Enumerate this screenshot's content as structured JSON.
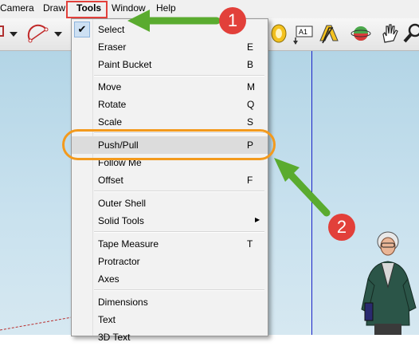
{
  "menubar": {
    "items": [
      "Camera",
      "Draw",
      "Tools",
      "Window",
      "Help"
    ]
  },
  "tools_menu": {
    "items": [
      {
        "label": "Select",
        "key": "",
        "checked": true
      },
      {
        "label": "Eraser",
        "key": "E"
      },
      {
        "label": "Paint Bucket",
        "key": "B"
      },
      {
        "label": "Move",
        "key": "M"
      },
      {
        "label": "Rotate",
        "key": "Q"
      },
      {
        "label": "Scale",
        "key": "S"
      },
      {
        "label": "Push/Pull",
        "key": "P",
        "highlighted": true
      },
      {
        "label": "Follow Me",
        "key": ""
      },
      {
        "label": "Offset",
        "key": "F"
      },
      {
        "label": "Outer Shell",
        "key": ""
      },
      {
        "label": "Solid Tools",
        "key": "",
        "submenu": true
      },
      {
        "label": "Tape Measure",
        "key": "T"
      },
      {
        "label": "Protractor",
        "key": ""
      },
      {
        "label": "Axes",
        "key": ""
      },
      {
        "label": "Dimensions",
        "key": ""
      },
      {
        "label": "Text",
        "key": ""
      },
      {
        "label": "3D Text",
        "key": ""
      }
    ]
  },
  "toolbar": {
    "icons": [
      "rectangle-dropdown-icon",
      "arc-icon",
      "arc-dropdown-icon",
      "paint-bucket-icon",
      "text-icon",
      "3d-text-icon",
      "rotate-icon",
      "pan-icon",
      "zoom-icon"
    ]
  },
  "annotations": {
    "step1": "1",
    "step2": "2",
    "arrow_color": "#5aab2f",
    "badge_color": "#e2403a",
    "oval_color": "#f39a1d",
    "highlight_color": "#e2403a"
  },
  "colors": {
    "axis_blue": "#1a22c8",
    "sky": "#c0dcea"
  }
}
